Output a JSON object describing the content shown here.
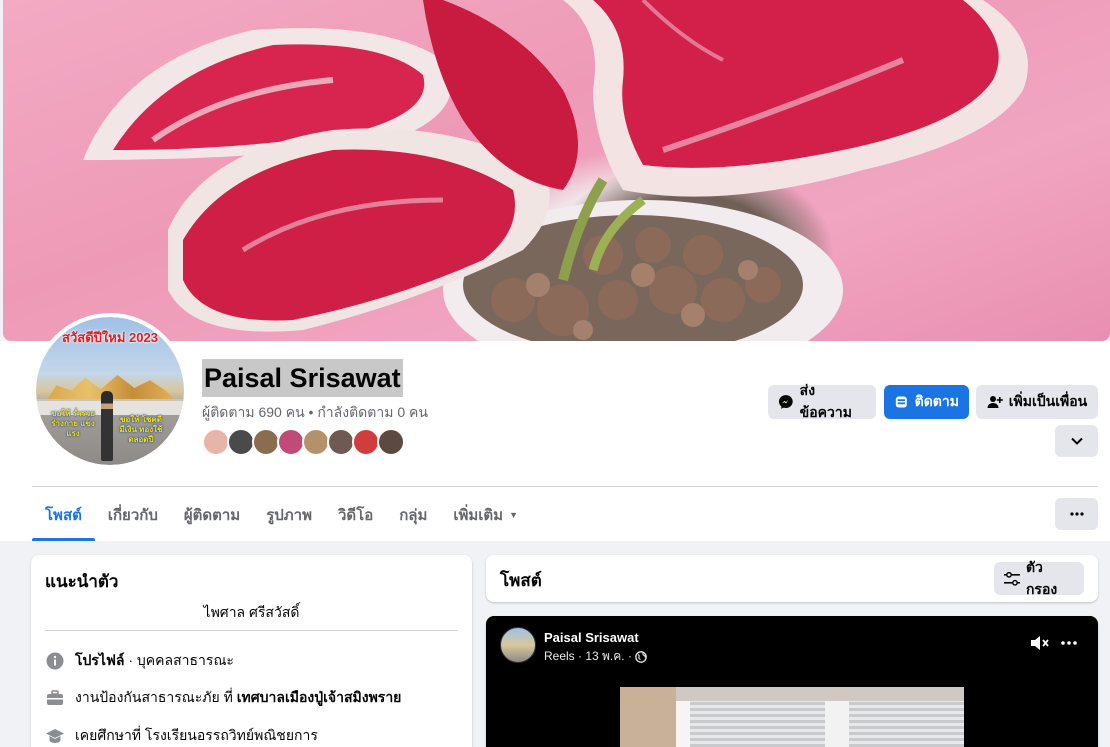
{
  "profile": {
    "name": "Paisal Srisawat",
    "stats": "ผู้ติดตาม 690 คน • กำลังติดตาม 0 คน",
    "avatar_caption": "สวัสดีปีใหม่ 2023",
    "avatar_text_left": "ขอให้ ร่ำรวย ร่างกาย แข็งแรง",
    "avatar_text_right": "ขอให้ โชคดี มีเงิน ทองใช้ ตลอดปี",
    "friend_colors": [
      "#e8b4a8",
      "#4a4a4a",
      "#8a6d4e",
      "#c04a7a",
      "#b5916b",
      "#6e5a52",
      "#d13d3d",
      "#5c4a40"
    ]
  },
  "actions": {
    "message_label": "ส่งข้อความ",
    "follow_label": "ติดตาม",
    "add_friend_label": "เพิ่มเป็นเพื่อน"
  },
  "tabs": [
    {
      "label": "โพสต์",
      "active": true
    },
    {
      "label": "เกี่ยวกับ"
    },
    {
      "label": "ผู้ติดตาม"
    },
    {
      "label": "รูปภาพ"
    },
    {
      "label": "วิดีโอ"
    },
    {
      "label": "กลุ่ม"
    },
    {
      "label": "เพิ่มเติม"
    }
  ],
  "intro": {
    "title": "แนะนำตัว",
    "bio": "ไพศาล ศรีสวัสดิ์",
    "rows": [
      {
        "icon": "info-icon",
        "bold": "โปรไฟล์",
        "text": " · บุคคลสาธารณะ"
      },
      {
        "icon": "briefcase-icon",
        "text": "งานป้องกันสาธารณะภัย ที่ ",
        "bold": "เทศบาลเมืองปู่เจ้าสมิงพราย"
      },
      {
        "icon": "graduation-cap-icon",
        "text": "เคยศึกษาที่ โรงเรียนอรรถวิทย์พณิชยการ"
      }
    ]
  },
  "posts": {
    "title": "โพสต์",
    "filter_label": "ตัวกรอง"
  },
  "reel": {
    "author": "Paisal Srisawat",
    "meta": "Reels · 13 พ.ค. ·"
  },
  "colors": {
    "accent": "#1b74e4",
    "cover_pink": "#ee9ab7",
    "leaf_red": "#d31f48"
  }
}
